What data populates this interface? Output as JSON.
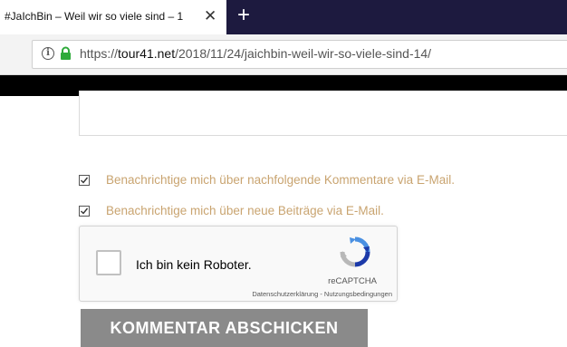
{
  "browser": {
    "tab_title": "#JaIchBin – Weil wir so viele sind – 1",
    "tab_close": "✕",
    "new_tab": "+",
    "url_prefix": "https://",
    "url_domain": "tour41.net",
    "url_path": "/2018/11/24/jaichbin-weil-wir-so-viele-sind-14/",
    "info_glyph": "i"
  },
  "comment_form": {
    "checkbox_comments": {
      "label": "Benachrichtige mich über nachfolgende Kommentare via E-Mail.",
      "checked": true
    },
    "checkbox_posts": {
      "label": "Benachrichtige mich über neue Beiträge via E-Mail.",
      "checked": true
    },
    "recaptcha": {
      "label": "Ich bin kein Roboter.",
      "brand": "reCAPTCHA",
      "links": "Datenschutzerklärung - Nutzungsbedingungen"
    },
    "submit_label": "KOMMENTAR ABSCHICKEN"
  },
  "colors": {
    "tab_bar": "#1d1a3f",
    "checkbox_label": "#c9a470",
    "submit_bg": "#8a8a8a",
    "lock": "#2eaa3a"
  }
}
